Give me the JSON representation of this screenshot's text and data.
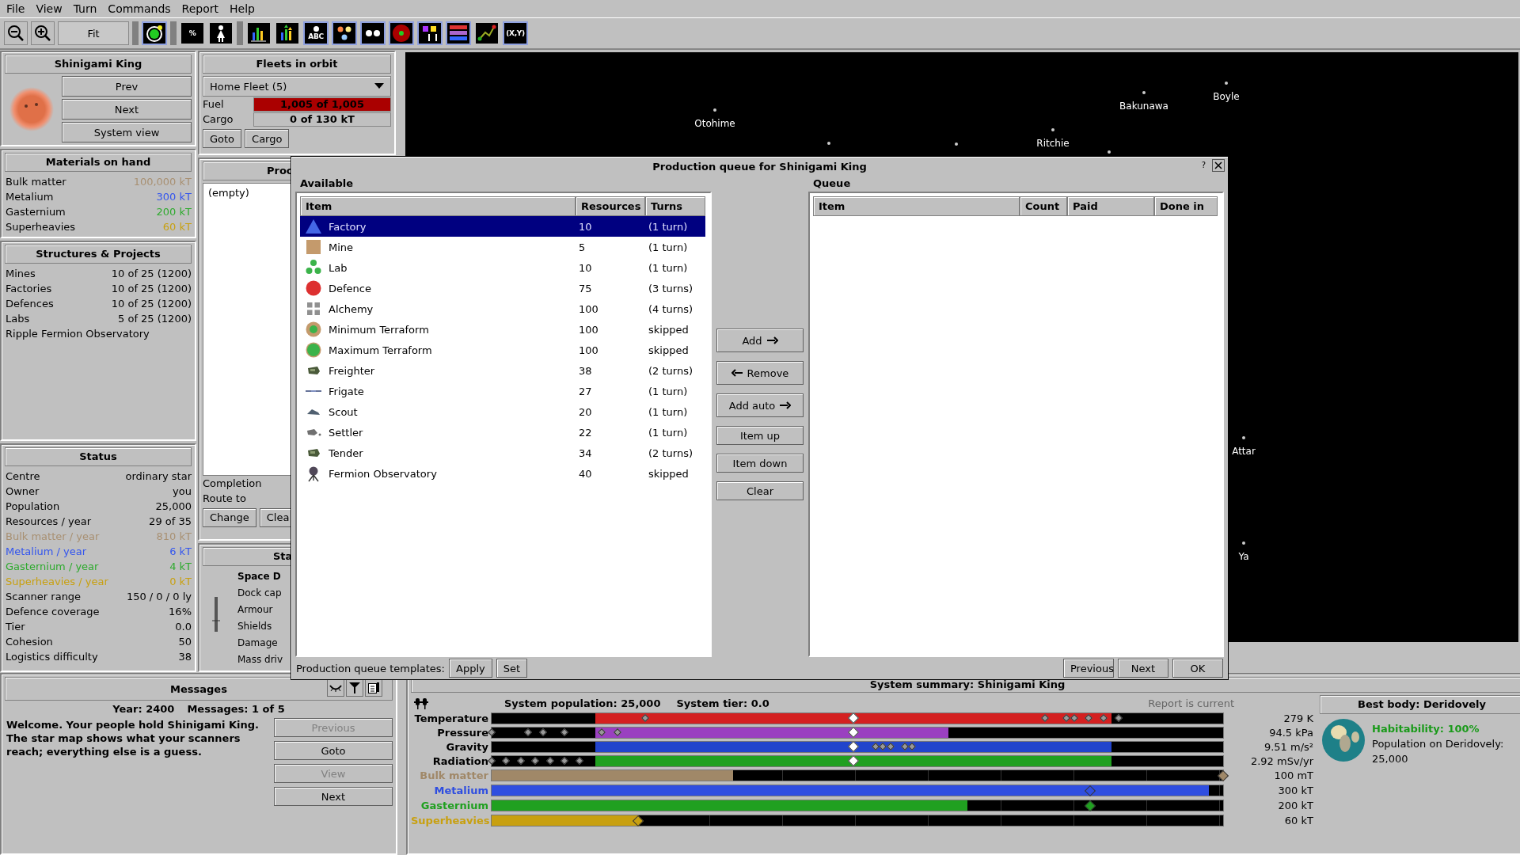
{
  "menu": [
    "File",
    "View",
    "Turn",
    "Commands",
    "Report",
    "Help"
  ],
  "toolbar": {
    "fit": "Fit",
    "tools": [
      {
        "kind": "planet",
        "selected": true
      },
      {
        "kind": "text",
        "label": "%",
        "selected": false
      },
      {
        "kind": "person",
        "selected": false
      },
      {
        "kind": "bars",
        "selected": false
      },
      {
        "kind": "bars-arrows",
        "selected": false
      },
      {
        "kind": "labelled-dot",
        "label": "ABC",
        "selected": true
      },
      {
        "kind": "colored-dots",
        "selected": true
      },
      {
        "kind": "white-dots",
        "selected": true
      },
      {
        "kind": "red-circle",
        "selected": true
      },
      {
        "kind": "flags",
        "selected": true
      },
      {
        "kind": "stripes",
        "selected": true
      },
      {
        "kind": "line",
        "selected": false
      },
      {
        "kind": "text",
        "label": "(X,Y)",
        "selected": true
      }
    ]
  },
  "system": {
    "name": "Shinigami King",
    "buttons": [
      "Prev",
      "Next",
      "System view"
    ]
  },
  "materials": {
    "title": "Materials on hand",
    "rows": [
      {
        "label": "Bulk matter",
        "value": "100,000 kT",
        "color": "#a89072"
      },
      {
        "label": "Metalium",
        "value": "300 kT",
        "color": "#3355ee"
      },
      {
        "label": "Gasternium",
        "value": "200 kT",
        "color": "#2eaa2e"
      },
      {
        "label": "Superheavies",
        "value": "60 kT",
        "color": "#c8a010"
      }
    ]
  },
  "structures": {
    "title": "Structures & Projects",
    "rows": [
      {
        "label": "Mines",
        "value": "10 of 25 (1200)"
      },
      {
        "label": "Factories",
        "value": "10 of 25 (1200)"
      },
      {
        "label": "Defences",
        "value": "10 of 25 (1200)"
      },
      {
        "label": "Labs",
        "value": "5 of 25 (1200)"
      },
      {
        "label": "Ripple Fermion Observatory"
      }
    ]
  },
  "status": {
    "title": "Status",
    "rows": [
      {
        "label": "Centre",
        "value": "ordinary star"
      },
      {
        "label": "Owner",
        "value": "you"
      },
      {
        "label": "Population",
        "value": "25,000"
      },
      {
        "label": "Resources / year",
        "value": "29 of 35"
      },
      {
        "label": "Bulk matter / year",
        "value": "810 kT",
        "color": "#a89072"
      },
      {
        "label": "Metalium / year",
        "value": "6 kT",
        "color": "#3355ee"
      },
      {
        "label": "Gasternium / year",
        "value": "4 kT",
        "color": "#2eaa2e"
      },
      {
        "label": "Superheavies / year",
        "value": "0 kT",
        "color": "#c8a010"
      },
      {
        "label": "Scanner range",
        "value": "150 / 0 / 0 ly"
      },
      {
        "label": "Defence coverage",
        "value": "16%"
      },
      {
        "label": "Tier",
        "value": "0.0"
      },
      {
        "label": "Cohesion",
        "value": "50"
      },
      {
        "label": "Logistics difficulty",
        "value": "38"
      }
    ]
  },
  "fleets": {
    "title": "Fleets in orbit",
    "fleet": "Home Fleet (5)",
    "fuel": {
      "label": "Fuel",
      "value": "1,005 of 1,005",
      "level": 1
    },
    "cargo": {
      "label": "Cargo",
      "value": "0 of 130 kT",
      "level": 0
    },
    "buttons": [
      "Goto",
      "Cargo"
    ]
  },
  "production_panel": {
    "title": "Proc",
    "list": [
      "(empty)"
    ],
    "completion": "Completion",
    "route": "Route to",
    "buttons": [
      "Change",
      "Clea"
    ]
  },
  "starbase_panel": {
    "title": "Sta",
    "heading": "Space D",
    "rows": [
      "Dock cap",
      "Armour",
      "Shields",
      "Damage",
      "Mass driv"
    ]
  },
  "map": {
    "stars": [
      {
        "name": "Otohime"
      },
      {
        "name": "Bakunawa"
      },
      {
        "name": "Boyle"
      },
      {
        "name": "Ritchie"
      },
      {
        "name": "Attar"
      },
      {
        "name": "Ya"
      }
    ]
  },
  "dialog": {
    "title": "Production queue for Shinigami King",
    "help": "?",
    "available": {
      "label": "Available",
      "columns": [
        "Item",
        "Resources",
        "Turns"
      ],
      "rows": [
        {
          "kind": "factory",
          "item": "Factory",
          "resources": "10",
          "turns": "(1 turn)",
          "selected": true
        },
        {
          "kind": "mine",
          "item": "Mine",
          "resources": "5",
          "turns": "(1 turn)",
          "selected": false
        },
        {
          "kind": "lab",
          "item": "Lab",
          "resources": "10",
          "turns": "(1 turn)",
          "selected": false
        },
        {
          "kind": "defence",
          "item": "Defence",
          "resources": "75",
          "turns": "(3 turns)",
          "selected": false
        },
        {
          "kind": "alchemy",
          "item": "Alchemy",
          "resources": "100",
          "turns": "(4 turns)",
          "selected": false
        },
        {
          "kind": "min-terraform",
          "item": "Minimum Terraform",
          "resources": "100",
          "turns": "skipped",
          "selected": false
        },
        {
          "kind": "max-terraform",
          "item": "Maximum Terraform",
          "resources": "100",
          "turns": "skipped",
          "selected": false
        },
        {
          "kind": "ship",
          "item": "Freighter",
          "resources": "38",
          "turns": "(2 turns)",
          "selected": false
        },
        {
          "kind": "frigate",
          "item": "Frigate",
          "resources": "27",
          "turns": "(1 turn)",
          "selected": false
        },
        {
          "kind": "scout",
          "item": "Scout",
          "resources": "20",
          "turns": "(1 turn)",
          "selected": false
        },
        {
          "kind": "settler",
          "item": "Settler",
          "resources": "22",
          "turns": "(1 turn)",
          "selected": false
        },
        {
          "kind": "ship",
          "item": "Tender",
          "resources": "34",
          "turns": "(2 turns)",
          "selected": false
        },
        {
          "kind": "observatory",
          "item": "Fermion Observatory",
          "resources": "40",
          "turns": "skipped",
          "selected": false
        }
      ]
    },
    "buttons": [
      {
        "label": "Add",
        "kind": "arrow-right"
      },
      {
        "label": "Remove",
        "kind": "arrow-left"
      },
      {
        "label": "Add auto",
        "kind": "arrow-right"
      },
      {
        "label": "Item up",
        "kind": "plain"
      },
      {
        "label": "Item down",
        "kind": "plain"
      },
      {
        "label": "Clear",
        "kind": "plain"
      }
    ],
    "queue": {
      "label": "Queue",
      "columns": [
        "Item",
        "Count",
        "Paid",
        "Done in"
      ]
    },
    "templates": {
      "label": "Production queue templates:",
      "buttons": [
        "Apply",
        "Set"
      ]
    },
    "nav": [
      "Previous",
      "Next",
      "OK"
    ]
  },
  "messages": {
    "title": "Messages",
    "year": "Year: 2400",
    "count": "Messages: 1 of 5",
    "text": "Welcome. Your people hold Shinigami King. The star map shows what your scanners reach; everything else is a guess.",
    "buttons": [
      {
        "label": "Previous",
        "disabled": true
      },
      {
        "label": "Goto",
        "disabled": false
      },
      {
        "label": "View",
        "disabled": true
      },
      {
        "label": "Next",
        "disabled": false
      }
    ]
  },
  "summary": {
    "title": "System summary: Shinigami King",
    "population": "System population: 25,000",
    "tier": "System tier: 0.0",
    "report": "Report is current",
    "environment": [
      {
        "label": "Temperature",
        "reading": "279 K",
        "color": "#d42020"
      },
      {
        "label": "Pressure",
        "reading": "94.5 kPa",
        "color": "#9a40c0"
      },
      {
        "label": "Gravity",
        "reading": "9.51 m/s²",
        "color": "#2244cc"
      },
      {
        "label": "Radiation",
        "reading": "2.92 mSv/yr",
        "color": "#20a020"
      }
    ],
    "minerals": [
      {
        "label": "Bulk matter",
        "reading": "100 mT",
        "level": 0.33,
        "color": "#a08868"
      },
      {
        "label": "Metalium",
        "reading": "300 kT",
        "level": 0.98,
        "color": "#2f4ee0"
      },
      {
        "label": "Gasternium",
        "reading": "200 kT",
        "level": 0.65,
        "color": "#20a020"
      },
      {
        "label": "Superheavies",
        "reading": "60 kT",
        "level": 0.2,
        "color": "#c8a010"
      }
    ],
    "best": {
      "title": "Best body: Deridovely",
      "habitability": "Habitability: 100%",
      "population_label": "Population on Deridovely:",
      "population": "25,000"
    }
  }
}
